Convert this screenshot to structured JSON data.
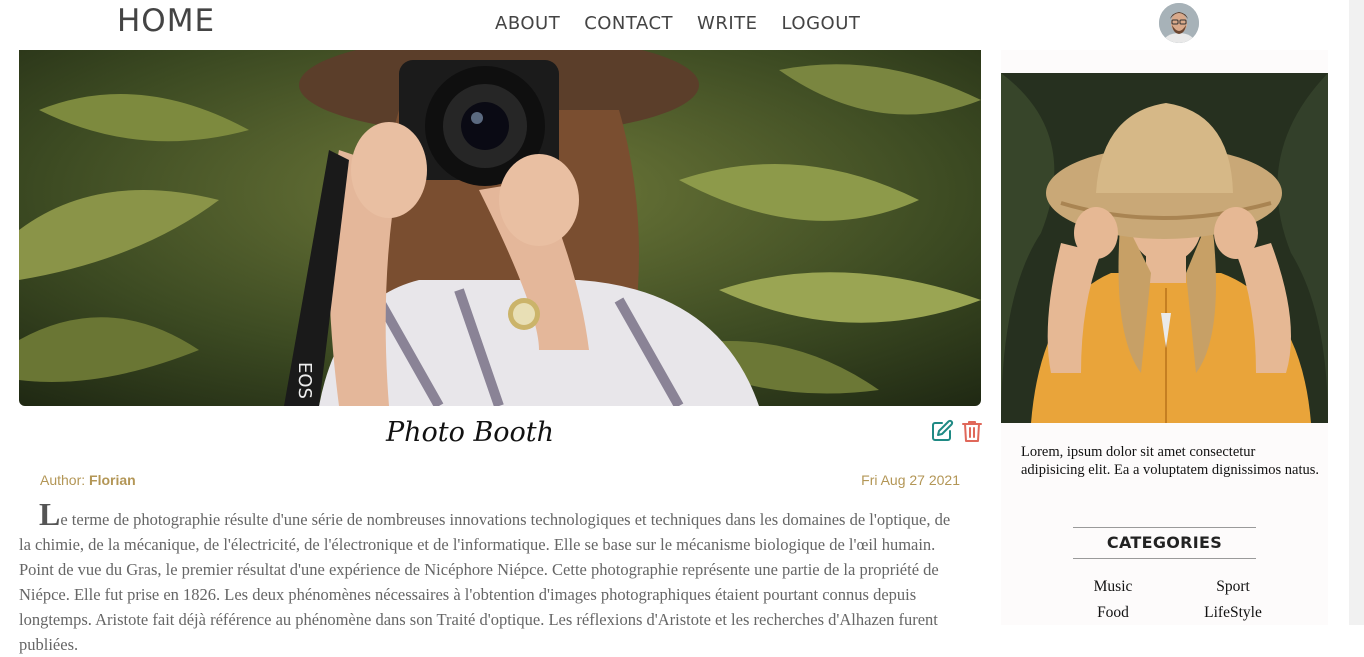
{
  "header": {
    "logo": "HOME",
    "nav": [
      "ABOUT",
      "CONTACT",
      "WRITE",
      "LOGOUT"
    ]
  },
  "post": {
    "title": "Photo Booth",
    "author_label": "Author:",
    "author_name": "Florian",
    "date": "Fri Aug 27 2021",
    "dropcap": "L",
    "body": "e terme de photographie résulte d'une série de nombreuses innovations technologiques et techniques dans les domaines de l'optique, de la chimie, de la mécanique, de l'électricité, de l'électronique et de l'informatique. Elle se base sur le mécanisme biologique de l'œil humain. Point de vue du Gras, le premier résultat d'une expérience de Nicéphore Niépce. Cette photographie représente une partie de la propriété de Niépce. Elle fut prise en 1826. Les deux phénomènes nécessaires à l'obtention d'images photographiques étaient pourtant connus depuis longtemps. Aristote fait déjà référence au phénomène dans son Traité d'optique. Les réflexions d'Aristote et les recherches d'Alhazen furent publiées."
  },
  "sidebar": {
    "about_text": "Lorem, ipsum dolor sit amet consectetur adipisicing elit. Ea a voluptatem dignissimos natus.",
    "categories_title": "CATEGORIES",
    "categories": [
      "Music",
      "Sport",
      "Food",
      "LifeStyle"
    ]
  },
  "colors": {
    "meta": "#b39656",
    "edit_icon": "#1f8a84",
    "delete_icon": "#e0685a"
  }
}
